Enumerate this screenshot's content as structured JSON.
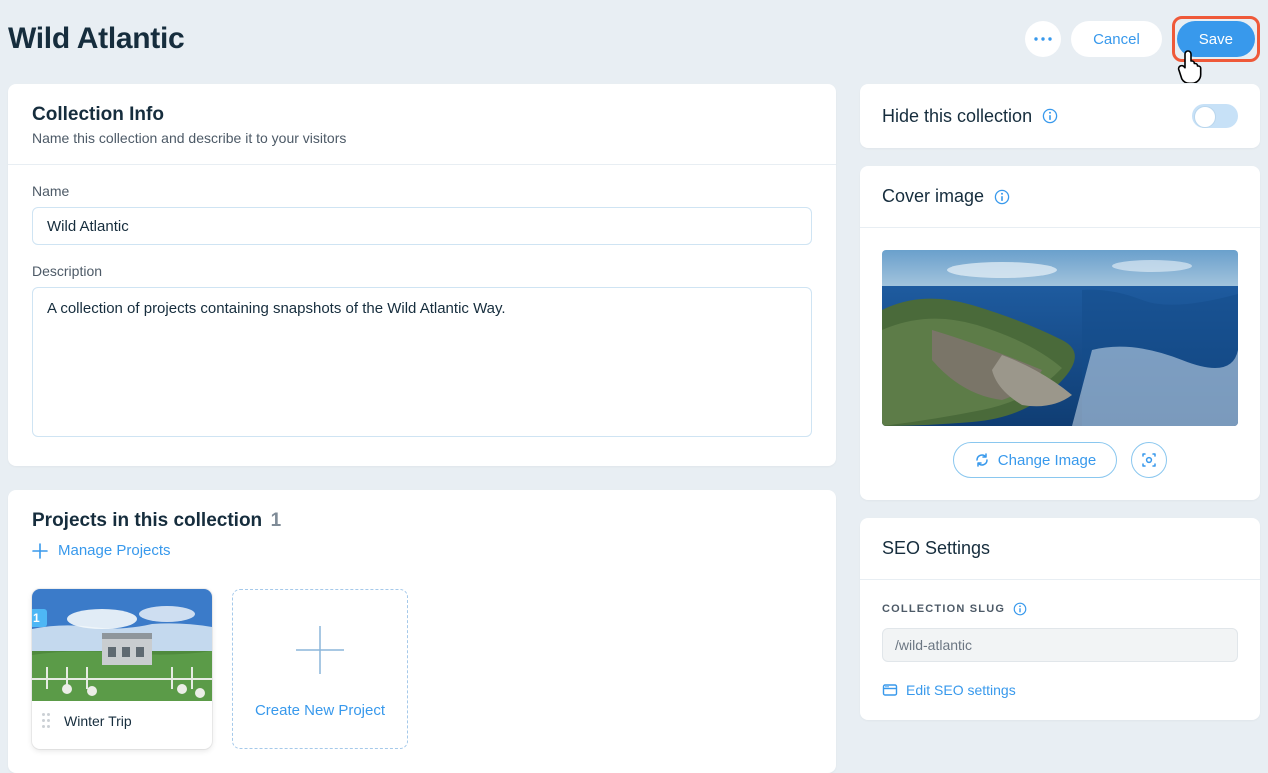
{
  "header": {
    "title": "Wild Atlantic",
    "cancel_label": "Cancel",
    "save_label": "Save"
  },
  "collection_info": {
    "title": "Collection Info",
    "subtitle": "Name this collection and describe it to your visitors",
    "name_label": "Name",
    "name_value": "Wild Atlantic",
    "description_label": "Description",
    "description_value": "A collection of projects containing snapshots of the Wild Atlantic Way."
  },
  "projects": {
    "title": "Projects in this collection",
    "count": "1",
    "manage_label": "Manage Projects",
    "items": [
      {
        "index": "1",
        "title": "Winter Trip"
      }
    ],
    "create_label": "Create New Project"
  },
  "hide_panel": {
    "label": "Hide this collection"
  },
  "cover_image": {
    "title": "Cover image",
    "change_label": "Change Image"
  },
  "seo": {
    "title": "SEO Settings",
    "slug_label": "COLLECTION SLUG",
    "slug_value": "/wild-atlantic",
    "edit_label": "Edit SEO settings"
  }
}
